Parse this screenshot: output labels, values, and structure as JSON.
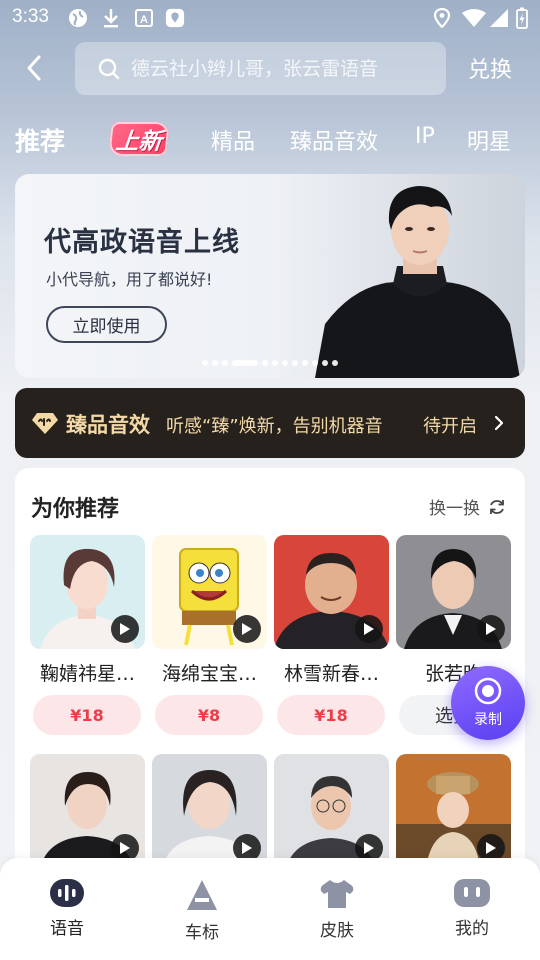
{
  "status_bar": {
    "time": "3:33"
  },
  "search": {
    "placeholder": "德云社小辫儿哥，张云雷语音",
    "redeem_label": "兑换"
  },
  "tabs": [
    {
      "label": "推荐"
    },
    {
      "label": "上新"
    },
    {
      "label": "精品"
    },
    {
      "label": "臻品音效"
    },
    {
      "label": "IP"
    },
    {
      "label": "明星"
    }
  ],
  "banner": {
    "title": "代高政语音上线",
    "subtitle": "小代导航，用了都说好!",
    "button_label": "立即使用"
  },
  "premium": {
    "title": "臻品音效",
    "description": "听感“臻”焕新，告别机器音",
    "status": "待开启"
  },
  "recommend": {
    "title": "为你推荐",
    "refresh_label": "换一换",
    "items": [
      {
        "name": "鞠婧祎星…",
        "price": "¥18"
      },
      {
        "name": "海绵宝宝…",
        "price": "¥8"
      },
      {
        "name": "林雪新春…",
        "price": "¥18"
      },
      {
        "name": "张若昀",
        "price": "选择"
      }
    ],
    "row2_count": 4
  },
  "record": {
    "label": "录制"
  },
  "bottom_nav": [
    {
      "label": "语音"
    },
    {
      "label": "车标"
    },
    {
      "label": "皮肤"
    },
    {
      "label": "我的"
    }
  ],
  "colors": {
    "accent": "#5a3ff2",
    "price_text": "#ef3b4a",
    "premium_gold": "#f3d9a6"
  }
}
